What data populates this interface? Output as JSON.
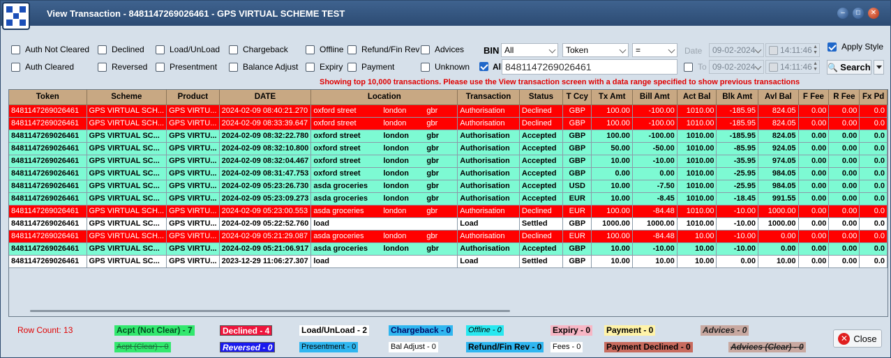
{
  "window": {
    "title": "View Transaction - 8481147269026461 - GPS VIRTUAL SCHEME TEST"
  },
  "filters": {
    "auth_not_cleared": "Auth Not Cleared",
    "auth_cleared": "Auth Cleared",
    "declined": "Declined",
    "reversed": "Reversed",
    "load_unload": "Load/UnLoad",
    "presentment": "Presentment",
    "chargeback": "Chargeback",
    "balance_adjust": "Balance Adjust",
    "offline": "Offline",
    "expiry": "Expiry",
    "refund_fin_rev": "Refund/Fin Rev",
    "payment": "Payment",
    "advices": "Advices",
    "unknown": "Unknown",
    "bin_label": "BIN",
    "bin_value": "All",
    "all_label": "All",
    "token_type": "Token",
    "operator": "=",
    "search_value": "8481147269026461",
    "date_label": "Date",
    "date_from": "09-02-2024",
    "time_from": "14:11:46",
    "to_label": "To",
    "date_to": "09-02-2024",
    "time_to": "14:11:46",
    "apply_style": "Apply Style",
    "search_button": "Search"
  },
  "notice": "Showing top 10,000 transactions. Please use the View transaction screen with a data range specified to show previous transactions",
  "table": {
    "columns": [
      "Token",
      "Scheme",
      "Product",
      "DATE",
      "Location",
      "Transaction",
      "Status",
      "T Ccy",
      "Tx Amt",
      "Bill Amt",
      "Act Bal",
      "Blk Amt",
      "Avl Bal",
      "F Fee",
      "R Fee",
      "Fx Pd"
    ],
    "rows": [
      {
        "style": "declined",
        "token": "8481147269026461",
        "scheme": "GPS VIRTUAL SCH...",
        "product": "GPS VIRTU...",
        "date": "2024-02-09 08:40:21.270",
        "loc1": "oxford street",
        "loc2": "london",
        "loc3": "gbr",
        "transaction": "Authorisation",
        "status": "Declined",
        "ccy": "GBP",
        "tx": "100.00",
        "bill": "-100.00",
        "act": "1010.00",
        "blk": "-185.95",
        "avl": "824.05",
        "ffee": "0.00",
        "rfee": "0.00",
        "fx": "0.0"
      },
      {
        "style": "declined",
        "token": "8481147269026461",
        "scheme": "GPS VIRTUAL SCH...",
        "product": "GPS VIRTU...",
        "date": "2024-02-09 08:33:39.647",
        "loc1": "oxford street",
        "loc2": "london",
        "loc3": "gbr",
        "transaction": "Authorisation",
        "status": "Declined",
        "ccy": "GBP",
        "tx": "100.00",
        "bill": "-100.00",
        "act": "1010.00",
        "blk": "-185.95",
        "avl": "824.05",
        "ffee": "0.00",
        "rfee": "0.00",
        "fx": "0.0"
      },
      {
        "style": "accepted",
        "token": "8481147269026461",
        "scheme": "GPS VIRTUAL SC...",
        "product": "GPS VIRTU...",
        "date": "2024-02-09 08:32:22.780",
        "loc1": "oxford street",
        "loc2": "london",
        "loc3": "gbr",
        "transaction": "Authorisation",
        "status": "Accepted",
        "ccy": "GBP",
        "tx": "100.00",
        "bill": "-100.00",
        "act": "1010.00",
        "blk": "-185.95",
        "avl": "824.05",
        "ffee": "0.00",
        "rfee": "0.00",
        "fx": "0.0"
      },
      {
        "style": "accepted",
        "token": "8481147269026461",
        "scheme": "GPS VIRTUAL SC...",
        "product": "GPS VIRTU...",
        "date": "2024-02-09 08:32:10.800",
        "loc1": "oxford street",
        "loc2": "london",
        "loc3": "gbr",
        "transaction": "Authorisation",
        "status": "Accepted",
        "ccy": "GBP",
        "tx": "50.00",
        "bill": "-50.00",
        "act": "1010.00",
        "blk": "-85.95",
        "avl": "924.05",
        "ffee": "0.00",
        "rfee": "0.00",
        "fx": "0.0"
      },
      {
        "style": "accepted",
        "token": "8481147269026461",
        "scheme": "GPS VIRTUAL SC...",
        "product": "GPS VIRTU...",
        "date": "2024-02-09 08:32:04.467",
        "loc1": "oxford street",
        "loc2": "london",
        "loc3": "gbr",
        "transaction": "Authorisation",
        "status": "Accepted",
        "ccy": "GBP",
        "tx": "10.00",
        "bill": "-10.00",
        "act": "1010.00",
        "blk": "-35.95",
        "avl": "974.05",
        "ffee": "0.00",
        "rfee": "0.00",
        "fx": "0.0"
      },
      {
        "style": "accepted",
        "token": "8481147269026461",
        "scheme": "GPS VIRTUAL SC...",
        "product": "GPS VIRTU...",
        "date": "2024-02-09 08:31:47.753",
        "loc1": "oxford street",
        "loc2": "london",
        "loc3": "gbr",
        "transaction": "Authorisation",
        "status": "Accepted",
        "ccy": "GBP",
        "tx": "0.00",
        "bill": "0.00",
        "act": "1010.00",
        "blk": "-25.95",
        "avl": "984.05",
        "ffee": "0.00",
        "rfee": "0.00",
        "fx": "0.0"
      },
      {
        "style": "accepted",
        "token": "8481147269026461",
        "scheme": "GPS VIRTUAL SC...",
        "product": "GPS VIRTU...",
        "date": "2024-02-09 05:23:26.730",
        "loc1": "asda groceries",
        "loc2": "london",
        "loc3": "gbr",
        "transaction": "Authorisation",
        "status": "Accepted",
        "ccy": "USD",
        "tx": "10.00",
        "bill": "-7.50",
        "act": "1010.00",
        "blk": "-25.95",
        "avl": "984.05",
        "ffee": "0.00",
        "rfee": "0.00",
        "fx": "0.0"
      },
      {
        "style": "accepted",
        "token": "8481147269026461",
        "scheme": "GPS VIRTUAL SC...",
        "product": "GPS VIRTU...",
        "date": "2024-02-09 05:23:09.273",
        "loc1": "asda groceries",
        "loc2": "london",
        "loc3": "gbr",
        "transaction": "Authorisation",
        "status": "Accepted",
        "ccy": "EUR",
        "tx": "10.00",
        "bill": "-8.45",
        "act": "1010.00",
        "blk": "-18.45",
        "avl": "991.55",
        "ffee": "0.00",
        "rfee": "0.00",
        "fx": "0.0"
      },
      {
        "style": "declined",
        "token": "8481147269026461",
        "scheme": "GPS VIRTUAL SCH...",
        "product": "GPS VIRTU...",
        "date": "2024-02-09 05:23:00.553",
        "loc1": "asda groceries",
        "loc2": "london",
        "loc3": "gbr",
        "transaction": "Authorisation",
        "status": "Declined",
        "ccy": "EUR",
        "tx": "100.00",
        "bill": "-84.48",
        "act": "1010.00",
        "blk": "-10.00",
        "avl": "1000.00",
        "ffee": "0.00",
        "rfee": "0.00",
        "fx": "0.0"
      },
      {
        "style": "settled",
        "token": "8481147269026461",
        "scheme": "GPS VIRTUAL SC...",
        "product": "GPS VIRTU...",
        "date": "2024-02-09 05:22:52.760",
        "loc1": "load",
        "loc2": "",
        "loc3": "",
        "transaction": "Load",
        "status": "Settled",
        "ccy": "GBP",
        "tx": "1000.00",
        "bill": "1000.00",
        "act": "1010.00",
        "blk": "-10.00",
        "avl": "1000.00",
        "ffee": "0.00",
        "rfee": "0.00",
        "fx": "0.0"
      },
      {
        "style": "declined",
        "token": "8481147269026461",
        "scheme": "GPS VIRTUAL SCH...",
        "product": "GPS VIRTU...",
        "date": "2024-02-09 05:21:29.087",
        "loc1": "asda groceries",
        "loc2": "london",
        "loc3": "gbr",
        "transaction": "Authorisation",
        "status": "Declined",
        "ccy": "EUR",
        "tx": "100.00",
        "bill": "-84.48",
        "act": "10.00",
        "blk": "-10.00",
        "avl": "0.00",
        "ffee": "0.00",
        "rfee": "0.00",
        "fx": "0.0"
      },
      {
        "style": "accepted",
        "token": "8481147269026461",
        "scheme": "GPS VIRTUAL SC...",
        "product": "GPS VIRTU...",
        "date": "2024-02-09 05:21:06.917",
        "loc1": "asda groceries",
        "loc2": "london",
        "loc3": "gbr",
        "transaction": "Authorisation",
        "status": "Accepted",
        "ccy": "GBP",
        "tx": "10.00",
        "bill": "-10.00",
        "act": "10.00",
        "blk": "-10.00",
        "avl": "0.00",
        "ffee": "0.00",
        "rfee": "0.00",
        "fx": "0.0"
      },
      {
        "style": "settled",
        "token": "8481147269026461",
        "scheme": "GPS VIRTUAL SC...",
        "product": "GPS VIRTU...",
        "date": "2023-12-29 11:06:27.307",
        "loc1": "load",
        "loc2": "",
        "loc3": "",
        "transaction": "Load",
        "status": "Settled",
        "ccy": "GBP",
        "tx": "10.00",
        "bill": "10.00",
        "act": "10.00",
        "blk": "0.00",
        "avl": "10.00",
        "ffee": "0.00",
        "rfee": "0.00",
        "fx": "0.0"
      }
    ]
  },
  "footer": {
    "row_count": "Row Count: 13",
    "legend": {
      "acpt_not_clear": "Acpt (Not Clear) - 7",
      "acpt_clear": "Acpt (Clear) - 0",
      "declined": "Declined - 4",
      "reversed": "Reversed - 0",
      "load_unload": "Load/UnLoad - 2",
      "presentment": "Presentment - 0",
      "chargeback": "Chargeback - 0",
      "bal_adjust": "Bal Adjust - 0",
      "offline": "Offline - 0",
      "refund_fin_rev": "Refund/Fin Rev - 0",
      "expiry": "Expiry - 0",
      "fees": "Fees - 0",
      "payment": "Payment - 0",
      "payment_declined": "Payment Declined - 0",
      "advices": "Advices - 0",
      "advices_clear": "Advices (Clear) - 0"
    },
    "close_button": "Close"
  },
  "colors": {
    "declined_row": "#ff0000",
    "accepted_row": "#7dfad3",
    "settled_row": "#ffffff",
    "header_bg": "#c8a883"
  }
}
